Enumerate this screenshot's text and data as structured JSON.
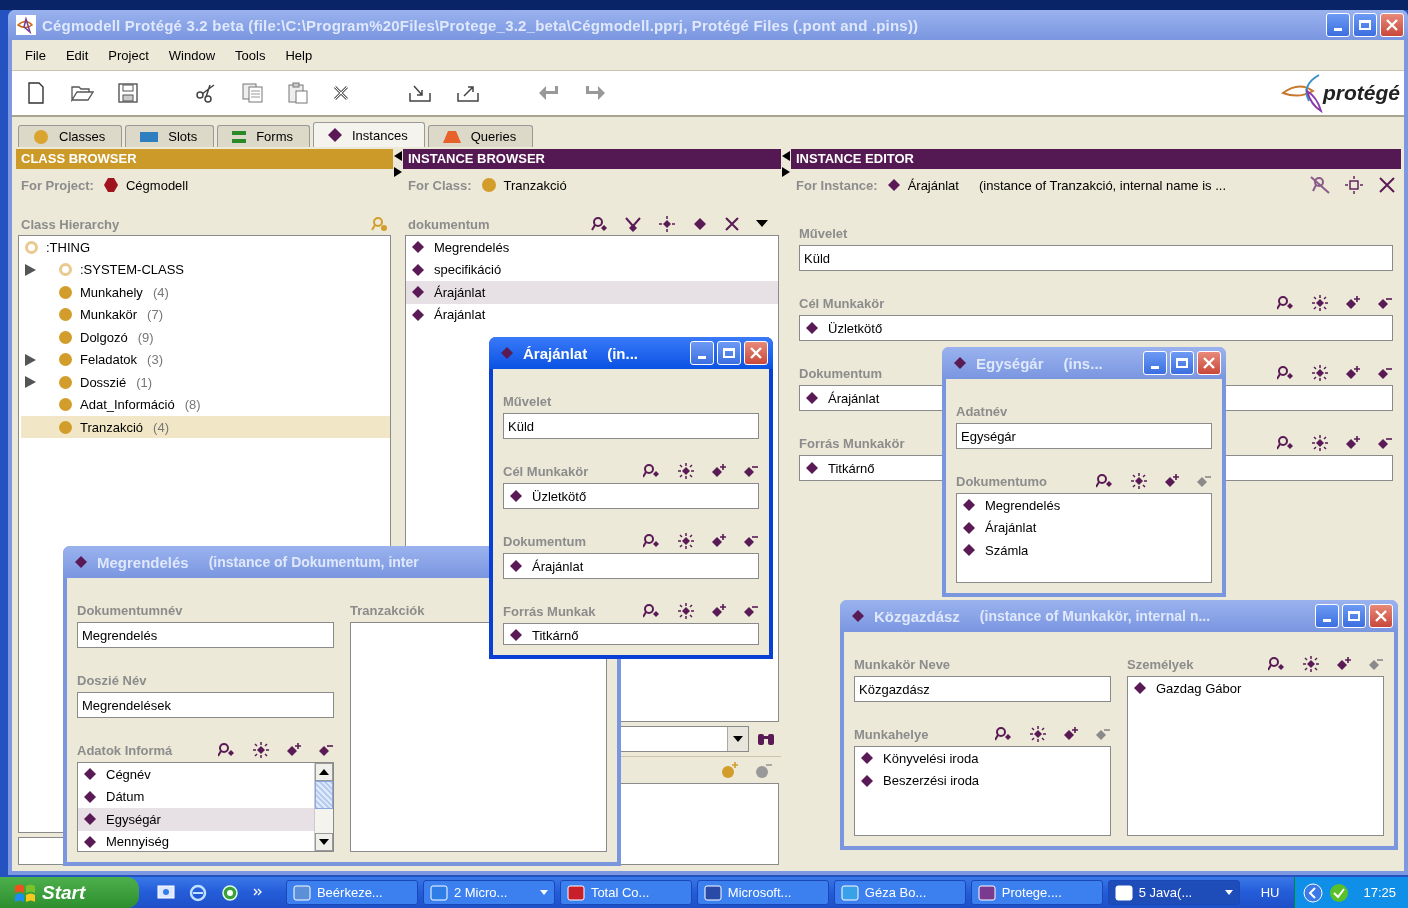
{
  "window": {
    "title": "Cégmodell  Protégé 3.2 beta    (file:\\C:\\Program%20Files\\Protege_3.2_beta\\Cégmodell.pprj, Protégé Files (.pont and .pins))"
  },
  "menu": [
    "File",
    "Edit",
    "Project",
    "Window",
    "Tools",
    "Help"
  ],
  "logo": {
    "text": "protégé"
  },
  "tabs": [
    {
      "label": "Classes",
      "kind": "classes",
      "selected": false
    },
    {
      "label": "Slots",
      "kind": "slots",
      "selected": false
    },
    {
      "label": "Forms",
      "kind": "forms",
      "selected": false
    },
    {
      "label": "Instances",
      "kind": "instances",
      "selected": true
    },
    {
      "label": "Queries",
      "kind": "queries",
      "selected": false
    }
  ],
  "class_browser": {
    "title": "CLASS BROWSER",
    "project_label": "For Project:",
    "project": "Cégmodell",
    "hierarchy_label": "Class Hierarchy",
    "tree": [
      {
        "label": ":THING",
        "abstract": true,
        "selected": false,
        "children": [
          {
            "label": ":SYSTEM-CLASS",
            "abstract": true,
            "expandable": true,
            "selected": false
          },
          {
            "label": "Munkahely",
            "count": "(4)",
            "abstract": false,
            "expandable": false,
            "selected": false
          },
          {
            "label": "Munkakör",
            "count": "(7)",
            "abstract": false,
            "expandable": false,
            "selected": false
          },
          {
            "label": "Dolgozó",
            "count": "(9)",
            "abstract": false,
            "expandable": false,
            "selected": false
          },
          {
            "label": "Feladatok",
            "count": "(3)",
            "abstract": false,
            "expandable": true,
            "selected": false
          },
          {
            "label": "Dosszié",
            "count": "(1)",
            "abstract": false,
            "expandable": true,
            "selected": false
          },
          {
            "label": "Adat_Információ",
            "count": "(8)",
            "abstract": false,
            "expandable": false,
            "selected": false
          },
          {
            "label": "Tranzakció",
            "count": "(4)",
            "abstract": false,
            "expandable": false,
            "selected": true
          }
        ]
      }
    ]
  },
  "instance_browser": {
    "title": "INSTANCE BROWSER",
    "class_label": "For Class:",
    "class": "Tranzakció",
    "list_label": "dokumentum",
    "instances": [
      {
        "label": "Megrendelés",
        "selected": false
      },
      {
        "label": "specifikáció",
        "selected": false
      },
      {
        "label": "Árajánlat",
        "selected": true
      },
      {
        "label": "Árajánlat",
        "selected": false
      }
    ]
  },
  "instance_editor": {
    "title": "INSTANCE EDITOR",
    "instance_label": "For Instance:",
    "instance": "Árajánlat",
    "note": "(instance of Tranzakció, internal name is ...",
    "slots": [
      {
        "kind": "text",
        "label": "Művelet",
        "value": "Küld"
      },
      {
        "kind": "list",
        "label": "Cél Munkakör",
        "remove_enabled": true,
        "items": [
          {
            "label": "Üzletkötő",
            "selected": false
          }
        ]
      },
      {
        "kind": "list",
        "label": "Dokumentum",
        "remove_enabled": true,
        "items": [
          {
            "label": "Árajánlat",
            "selected": false
          }
        ]
      },
      {
        "kind": "list",
        "label": "Forrás Munkakör",
        "remove_enabled": true,
        "items": [
          {
            "label": "Titkárnő",
            "selected": false
          }
        ]
      }
    ]
  },
  "windows": [
    {
      "title": "Megrendelés",
      "subtitle": "(instance of Dokumentum, inter",
      "active": false,
      "columns": [
        [
          {
            "kind": "text",
            "label": "Dokumentumnév",
            "value": "Megrendelés"
          },
          {
            "kind": "text",
            "label": "Doszié Név",
            "value": "Megrendelések"
          },
          {
            "kind": "scrolllist",
            "label": "Adatok Informá",
            "remove_enabled": true,
            "items": [
              {
                "label": "Cégnév",
                "selected": false
              },
              {
                "label": "Dátum",
                "selected": false
              },
              {
                "label": "Egységár",
                "selected": true
              },
              {
                "label": "Mennyiség",
                "selected": false
              }
            ]
          }
        ],
        [
          {
            "kind": "plainlist",
            "label": "Tranzakciók"
          }
        ]
      ]
    },
    {
      "title": "Árajánlat",
      "subtitle": "(in...",
      "active": true,
      "columns": [
        [
          {
            "kind": "text",
            "label": "Művelet",
            "value": "Küld"
          },
          {
            "kind": "list",
            "label": "Cél Munkakör",
            "remove_enabled": true,
            "items": [
              {
                "label": "Üzletkötő",
                "selected": false
              }
            ]
          },
          {
            "kind": "list",
            "label": "Dokumentum",
            "remove_enabled": true,
            "items": [
              {
                "label": "Árajánlat",
                "selected": false
              }
            ]
          },
          {
            "kind": "list",
            "label": "Forrás Munkak",
            "remove_enabled": true,
            "items": [
              {
                "label": "Titkárnő",
                "selected": false
              }
            ]
          }
        ]
      ]
    },
    {
      "title": "Egységár",
      "subtitle": "(ins...",
      "active": false,
      "columns": [
        [
          {
            "kind": "text",
            "label": "Adatnév",
            "value": "Egységár"
          },
          {
            "kind": "list",
            "label": "Dokumentumo",
            "remove_enabled": false,
            "items": [
              {
                "label": "Megrendelés",
                "selected": false
              },
              {
                "label": "Árajánlat",
                "selected": false
              },
              {
                "label": "Számla",
                "selected": false
              }
            ]
          }
        ]
      ]
    },
    {
      "title": "Közgazdász",
      "subtitle": "(instance of Munkakör, internal n...",
      "active": false,
      "columns": [
        [
          {
            "kind": "text",
            "label": "Munkakör Neve",
            "value": "Közgazdász"
          },
          {
            "kind": "list",
            "label": "Munkahelye",
            "remove_enabled": false,
            "items": [
              {
                "label": "Könyvelési iroda",
                "selected": false
              },
              {
                "label": "Beszerzési iroda",
                "selected": false
              }
            ]
          }
        ],
        [
          {
            "kind": "list",
            "label": "Személyek",
            "remove_enabled": false,
            "items": [
              {
                "label": "Gazdag Gábor",
                "selected": false
              }
            ]
          }
        ]
      ]
    }
  ],
  "taskbar": {
    "start": "Start",
    "tasks": [
      {
        "label": "Beérkeze...",
        "kind": "mail",
        "grouped": false,
        "selected": false
      },
      {
        "label": "2 Micro...",
        "kind": "browser",
        "grouped": true,
        "selected": false
      },
      {
        "label": "Total Co...",
        "kind": "disk",
        "grouped": false,
        "selected": false
      },
      {
        "label": "Microsoft...",
        "kind": "word",
        "grouped": false,
        "selected": false
      },
      {
        "label": "Géza Bo...",
        "kind": "chat",
        "grouped": false,
        "selected": false
      },
      {
        "label": "Protege....",
        "kind": "protege",
        "grouped": false,
        "selected": false
      },
      {
        "label": "5 Java(...",
        "kind": "window",
        "grouped": true,
        "selected": true
      }
    ],
    "language": "HU",
    "clock": "17:25"
  }
}
